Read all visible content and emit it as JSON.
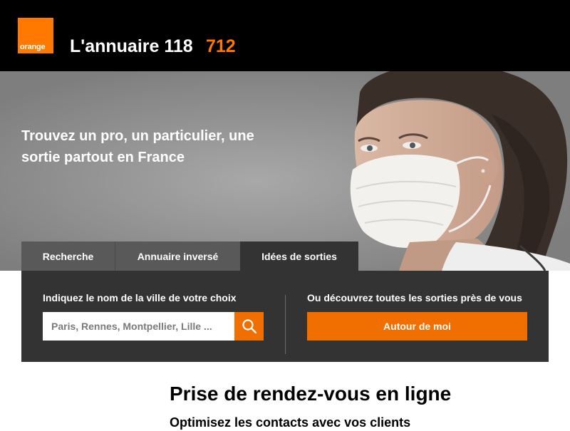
{
  "header": {
    "logo_text": "orange",
    "title": "L'annuaire 118",
    "number": "712"
  },
  "hero": {
    "tagline": "Trouvez un pro, un particulier, une sortie partout en France"
  },
  "tabs": [
    {
      "label": "Recherche",
      "active": false
    },
    {
      "label": "Annuaire inversé",
      "active": false
    },
    {
      "label": "Idées de sorties",
      "active": true
    }
  ],
  "search_panel": {
    "left_label": "Indiquez le nom de la ville de votre choix",
    "city_placeholder": "Paris, Rennes, Montpellier, Lille ...",
    "right_label": "Ou découvrez toutes les sorties près de vous",
    "around_button": "Autour de moi"
  },
  "content": {
    "title": "Prise de rendez-vous en ligne",
    "subtitle": "Optimisez les contacts avec vos clients"
  },
  "colors": {
    "brand_orange": "#ff7900",
    "button_orange": "#f16e00",
    "header_bg": "#000000",
    "panel_bg": "#333333",
    "tab_inactive": "#595959"
  }
}
